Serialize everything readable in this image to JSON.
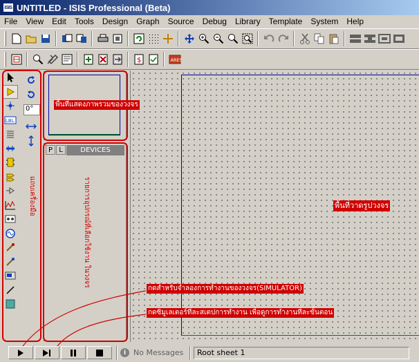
{
  "window": {
    "title": "UNTITLED - ISIS Professional (Beta)",
    "app_icon_text": "ISIS"
  },
  "menu": [
    "File",
    "View",
    "Edit",
    "Tools",
    "Design",
    "Graph",
    "Source",
    "Debug",
    "Library",
    "Template",
    "System",
    "Help"
  ],
  "toolbar1": [
    "new-file-icon",
    "open-folder-icon",
    "save-icon",
    "import-icon",
    "export-icon",
    "print-icon",
    "print-area-icon",
    "refresh-icon",
    "grid-icon",
    "origin-icon",
    "pan-icon",
    "zoom-in-icon",
    "zoom-out-icon",
    "zoom-all-icon",
    "zoom-area-icon",
    "undo-icon",
    "redo-icon",
    "cut-icon",
    "copy-icon",
    "paste-icon",
    "block-copy-icon",
    "block-move-icon",
    "block-rotate-icon",
    "block-delete-icon"
  ],
  "toolbar2": [
    "netlist-icon",
    "search-icon",
    "tools-icon",
    "design-explorer-icon",
    "new-sheet-icon",
    "remove-sheet-icon",
    "exit-sheet-icon",
    "bom-icon",
    "erc-icon",
    "ares-icon"
  ],
  "ares_label": "ARES",
  "angle": {
    "value": "0°"
  },
  "devices": {
    "p_label": "P",
    "l_label": "L",
    "title": "DEVICES"
  },
  "status": {
    "messages": "No Messages",
    "sheet": "Root sheet 1"
  },
  "annotations": {
    "overview": "พื้นที่แสดงภาพรวมของวงจร",
    "toolbar": "แถบเครื่องมือ",
    "device_list": "รายการอุปกรณ์ที่เลือกใช้งาน  ในวงจร",
    "drawing_area": "พื้นที่วาดรูปวงจร",
    "simulator": "กดสำหรับจำลองการทำงานของวงจร(SIMULATOR)",
    "step": "กดซิมูเลเตอร์ที่ละสเตปการทำงาน เพื่อดูการทำงานที่ละขั้นตอน"
  },
  "colors": {
    "annotation": "#d00000",
    "sheet_border": "#0000a0",
    "title_start": "#0a246a",
    "title_end": "#a6caf0"
  }
}
